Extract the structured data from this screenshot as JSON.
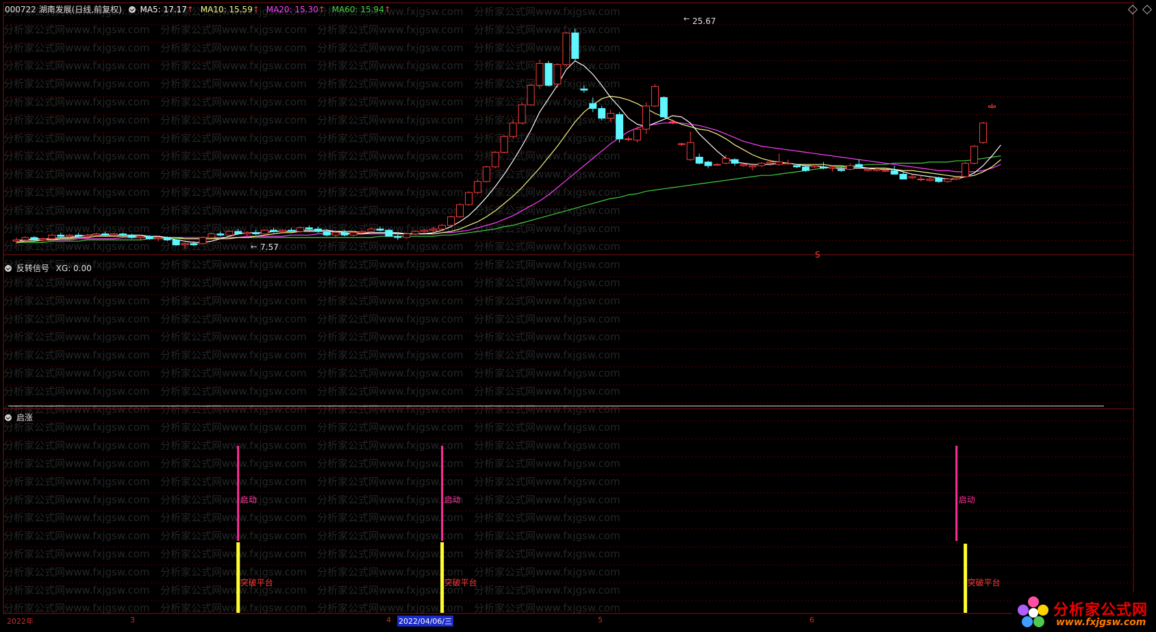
{
  "header": {
    "symbol_title": "000722 湖南发展(日线,前复权)",
    "ma5": "MA5: 17.17",
    "ma10": "MA10: 15.59",
    "ma20": "MA20: 15.30",
    "ma60": "MA60: 15.94",
    "arrow": "↑"
  },
  "colors": {
    "up": "#ff3c3c",
    "down": "#5ff6ff",
    "ma5": "#ffffff",
    "ma10": "#f5f58c",
    "ma20": "#ff40ff",
    "ma60": "#40d040",
    "grid": "#5a0000",
    "signal_start": "#ff2f9a",
    "signal_breakout": "#ffff30"
  },
  "price_pane": {
    "high_label": "25.67",
    "low_label": "7.57",
    "s_marker": "S",
    "price_range": [
      7.2,
      26.6
    ]
  },
  "reversal_pane": {
    "title": "反转信号",
    "value": "XG: 0.00"
  },
  "rise_pane": {
    "title": "启涨",
    "start_label": "启动",
    "breakout_label": "突破平台"
  },
  "date_axis": {
    "labels": [
      "2022年",
      "3",
      "4",
      "2022/04/06/三",
      "5",
      "6"
    ]
  },
  "watermark": {
    "text": "分析家公式网www.fxjgsw.com"
  },
  "logo": {
    "title": "分析家公式网",
    "url": "www.fxjgsw.com"
  },
  "chart_data": {
    "type": "candlestick",
    "ohlc": [
      [
        8.2,
        8.5,
        8.0,
        8.3
      ],
      [
        8.3,
        8.6,
        8.1,
        8.5
      ],
      [
        8.5,
        8.6,
        8.2,
        8.3
      ],
      [
        8.3,
        8.5,
        8.1,
        8.4
      ],
      [
        8.4,
        8.8,
        8.3,
        8.7
      ],
      [
        8.7,
        8.9,
        8.5,
        8.6
      ],
      [
        8.6,
        8.8,
        8.4,
        8.7
      ],
      [
        8.7,
        8.9,
        8.5,
        8.6
      ],
      [
        8.6,
        8.8,
        8.4,
        8.7
      ],
      [
        8.7,
        8.9,
        8.6,
        8.8
      ],
      [
        8.8,
        9.0,
        8.6,
        8.7
      ],
      [
        8.7,
        8.9,
        8.5,
        8.8
      ],
      [
        8.8,
        8.9,
        8.6,
        8.7
      ],
      [
        8.7,
        8.8,
        8.4,
        8.5
      ],
      [
        8.5,
        8.7,
        8.3,
        8.6
      ],
      [
        8.6,
        8.7,
        8.3,
        8.4
      ],
      [
        8.4,
        8.6,
        8.2,
        8.5
      ],
      [
        8.5,
        8.6,
        8.2,
        8.3
      ],
      [
        8.3,
        8.4,
        7.8,
        7.9
      ],
      [
        7.9,
        8.1,
        7.57,
        8.0
      ],
      [
        8.0,
        8.2,
        7.8,
        7.9
      ],
      [
        8.0,
        8.6,
        7.9,
        8.5
      ],
      [
        8.5,
        8.9,
        8.4,
        8.8
      ],
      [
        8.8,
        9.0,
        8.6,
        8.7
      ],
      [
        8.7,
        9.1,
        8.6,
        9.0
      ],
      [
        9.0,
        9.2,
        8.7,
        8.8
      ],
      [
        8.8,
        9.0,
        8.6,
        8.9
      ],
      [
        8.9,
        9.1,
        8.7,
        8.8
      ],
      [
        8.8,
        9.2,
        8.7,
        9.1
      ],
      [
        9.1,
        9.3,
        8.9,
        9.0
      ],
      [
        9.0,
        9.2,
        8.8,
        9.1
      ],
      [
        9.1,
        9.3,
        8.9,
        9.0
      ],
      [
        9.0,
        9.4,
        8.9,
        9.3
      ],
      [
        9.3,
        9.5,
        9.0,
        9.2
      ],
      [
        9.2,
        9.4,
        8.9,
        9.0
      ],
      [
        9.0,
        9.2,
        8.6,
        8.7
      ],
      [
        8.7,
        9.0,
        8.5,
        8.9
      ],
      [
        8.9,
        9.1,
        8.6,
        8.7
      ],
      [
        8.7,
        9.0,
        8.6,
        8.9
      ],
      [
        8.9,
        9.1,
        8.7,
        9.0
      ],
      [
        9.0,
        9.3,
        8.9,
        9.2
      ],
      [
        9.2,
        9.4,
        9.0,
        9.1
      ],
      [
        9.1,
        9.2,
        8.6,
        8.6
      ],
      [
        8.6,
        8.8,
        8.3,
        8.5
      ],
      [
        8.5,
        8.9,
        8.4,
        8.8
      ],
      [
        8.8,
        9.1,
        8.7,
        9.0
      ],
      [
        9.0,
        9.2,
        8.9,
        9.1
      ],
      [
        9.1,
        9.4,
        8.7,
        9.2
      ],
      [
        9.2,
        9.6,
        9.0,
        9.5
      ],
      [
        9.5,
        10.3,
        9.4,
        10.2
      ],
      [
        10.2,
        11.3,
        10.1,
        11.2
      ],
      [
        11.2,
        12.3,
        11.1,
        12.2
      ],
      [
        12.2,
        13.3,
        12.1,
        13.1
      ],
      [
        13.1,
        14.4,
        13.0,
        14.3
      ],
      [
        14.3,
        15.6,
        14.2,
        15.5
      ],
      [
        15.5,
        16.9,
        15.4,
        16.8
      ],
      [
        16.8,
        18.2,
        16.6,
        17.9
      ],
      [
        17.9,
        19.6,
        17.8,
        19.4
      ],
      [
        19.4,
        21.1,
        19.3,
        21.0
      ],
      [
        21.0,
        23.1,
        20.7,
        22.8
      ],
      [
        22.8,
        23.0,
        20.9,
        21.0
      ],
      [
        21.1,
        22.8,
        20.8,
        22.7
      ],
      [
        22.7,
        25.4,
        22.5,
        25.3
      ],
      [
        25.3,
        25.67,
        23.0,
        23.2
      ],
      [
        20.7,
        21.0,
        20.4,
        20.6
      ],
      [
        19.5,
        20.0,
        18.8,
        19.1
      ],
      [
        19.1,
        19.3,
        18.1,
        18.3
      ],
      [
        18.3,
        19.0,
        18.0,
        18.7
      ],
      [
        18.6,
        18.8,
        16.3,
        16.6
      ],
      [
        16.6,
        16.8,
        16.4,
        16.6
      ],
      [
        16.5,
        17.6,
        16.3,
        17.4
      ],
      [
        17.4,
        19.6,
        17.0,
        19.3
      ],
      [
        19.3,
        21.1,
        19.2,
        20.9
      ],
      [
        20.0,
        20.1,
        18.4,
        18.4
      ],
      [
        18.0,
        18.2,
        17.8,
        18.0
      ],
      [
        16.2,
        16.3,
        16.0,
        16.2
      ],
      [
        14.9,
        17.2,
        14.8,
        16.3
      ],
      [
        15.1,
        15.4,
        14.5,
        14.6
      ],
      [
        14.7,
        14.8,
        14.2,
        14.4
      ],
      [
        14.5,
        14.6,
        14.4,
        14.5
      ],
      [
        14.6,
        15.3,
        14.5,
        15.0
      ],
      [
        14.9,
        15.0,
        14.4,
        14.6
      ],
      [
        14.4,
        14.6,
        14.3,
        14.5
      ],
      [
        14.3,
        14.6,
        14.0,
        14.4
      ],
      [
        14.4,
        14.7,
        14.3,
        14.6
      ],
      [
        14.6,
        14.9,
        14.4,
        14.7
      ],
      [
        14.5,
        15.4,
        14.4,
        14.7
      ],
      [
        14.6,
        14.9,
        14.5,
        14.6
      ],
      [
        14.4,
        14.5,
        14.2,
        14.3
      ],
      [
        14.3,
        14.4,
        13.9,
        14.0
      ],
      [
        14.3,
        14.5,
        14.2,
        14.4
      ],
      [
        14.3,
        14.7,
        14.1,
        14.2
      ],
      [
        14.2,
        14.4,
        13.9,
        14.3
      ],
      [
        14.1,
        14.3,
        13.9,
        14.0
      ],
      [
        14.1,
        14.6,
        14.0,
        14.4
      ],
      [
        14.5,
        14.9,
        14.3,
        14.3
      ],
      [
        14.0,
        14.3,
        13.9,
        14.1
      ],
      [
        14.0,
        14.3,
        13.9,
        14.1
      ],
      [
        14.0,
        14.2,
        13.9,
        14.0
      ],
      [
        14.0,
        14.4,
        13.7,
        13.7
      ],
      [
        13.7,
        14.0,
        13.3,
        13.3
      ],
      [
        13.4,
        13.7,
        13.3,
        13.5
      ],
      [
        13.3,
        13.6,
        13.1,
        13.3
      ],
      [
        13.2,
        13.5,
        13.1,
        13.3
      ],
      [
        13.4,
        13.5,
        13.0,
        13.1
      ],
      [
        13.1,
        13.4,
        13.0,
        13.3
      ],
      [
        13.3,
        13.5,
        13.2,
        13.4
      ],
      [
        13.5,
        14.7,
        13.4,
        14.6
      ],
      [
        14.6,
        16.1,
        14.5,
        16.0
      ],
      [
        16.3,
        18.0,
        16.2,
        17.9
      ],
      [
        19.2,
        19.5,
        19.1,
        19.3
      ]
    ],
    "ma5": [
      8.2,
      8.3,
      8.4,
      8.4,
      8.4,
      8.5,
      8.5,
      8.6,
      8.7,
      8.7,
      8.7,
      8.7,
      8.7,
      8.7,
      8.7,
      8.6,
      8.6,
      8.5,
      8.3,
      8.2,
      8.1,
      8.1,
      8.2,
      8.4,
      8.6,
      8.8,
      8.9,
      8.9,
      8.9,
      9.0,
      9.0,
      9.0,
      9.1,
      9.1,
      9.1,
      9.1,
      9.0,
      8.9,
      8.8,
      8.8,
      8.9,
      8.9,
      8.9,
      8.9,
      8.8,
      8.8,
      8.8,
      8.9,
      9.1,
      9.4,
      9.8,
      10.3,
      11.0,
      11.8,
      12.7,
      13.7,
      14.8,
      16.0,
      17.3,
      18.8,
      19.9,
      21.0,
      22.3,
      23.0,
      22.6,
      21.9,
      21.0,
      20.0,
      19.2,
      18.3,
      17.8,
      17.6,
      17.9,
      18.2,
      18.5,
      18.4,
      17.9,
      17.0,
      16.3,
      15.6,
      15.0,
      14.7,
      14.6,
      14.5,
      14.5,
      14.5,
      14.6,
      14.6,
      14.5,
      14.4,
      14.4,
      14.3,
      14.2,
      14.2,
      14.2,
      14.2,
      14.2,
      14.1,
      14.1,
      14.1,
      13.9,
      13.7,
      13.6,
      13.5,
      13.4,
      13.3,
      13.3,
      13.5,
      13.8,
      14.4,
      15.2,
      16.1
    ],
    "ma10": [
      8.1,
      8.2,
      8.2,
      8.3,
      8.3,
      8.4,
      8.4,
      8.5,
      8.5,
      8.6,
      8.6,
      8.6,
      8.6,
      8.6,
      8.6,
      8.6,
      8.6,
      8.5,
      8.5,
      8.4,
      8.4,
      8.4,
      8.4,
      8.4,
      8.4,
      8.5,
      8.5,
      8.6,
      8.7,
      8.8,
      8.9,
      8.9,
      9.0,
      9.0,
      9.0,
      9.0,
      9.0,
      9.0,
      9.0,
      8.9,
      8.9,
      8.9,
      8.9,
      8.8,
      8.8,
      8.8,
      8.8,
      8.8,
      8.9,
      9.0,
      9.2,
      9.5,
      9.8,
      10.2,
      10.7,
      11.3,
      11.9,
      12.6,
      13.4,
      14.2,
      15.1,
      16.0,
      17.0,
      18.0,
      18.8,
      19.4,
      19.9,
      20.1,
      20.0,
      19.8,
      19.5,
      19.1,
      18.7,
      18.4,
      18.1,
      17.8,
      17.6,
      17.4,
      17.3,
      17.0,
      16.6,
      16.1,
      15.7,
      15.3,
      15.0,
      14.8,
      14.7,
      14.6,
      14.5,
      14.5,
      14.5,
      14.5,
      14.4,
      14.4,
      14.3,
      14.3,
      14.2,
      14.2,
      14.2,
      14.1,
      14.0,
      14.0,
      13.9,
      13.8,
      13.7,
      13.6,
      13.5,
      13.5,
      13.6,
      13.9,
      14.3,
      14.9
    ],
    "ma20": [
      8.3,
      8.3,
      8.3,
      8.3,
      8.3,
      8.3,
      8.3,
      8.4,
      8.4,
      8.4,
      8.4,
      8.4,
      8.5,
      8.5,
      8.5,
      8.5,
      8.5,
      8.5,
      8.5,
      8.5,
      8.5,
      8.5,
      8.5,
      8.5,
      8.5,
      8.5,
      8.6,
      8.6,
      8.6,
      8.6,
      8.6,
      8.7,
      8.7,
      8.7,
      8.8,
      8.8,
      8.8,
      8.8,
      8.8,
      8.8,
      8.8,
      8.8,
      8.8,
      8.8,
      8.8,
      8.8,
      8.8,
      8.8,
      8.9,
      8.9,
      9.0,
      9.1,
      9.3,
      9.5,
      9.7,
      10.0,
      10.3,
      10.7,
      11.1,
      11.5,
      12.0,
      12.6,
      13.2,
      13.8,
      14.4,
      15.0,
      15.6,
      16.2,
      16.7,
      17.2,
      17.5,
      17.7,
      17.8,
      17.9,
      17.9,
      17.9,
      17.8,
      17.7,
      17.5,
      17.3,
      17.0,
      16.7,
      16.4,
      16.2,
      16.0,
      15.9,
      15.8,
      15.7,
      15.6,
      15.5,
      15.4,
      15.3,
      15.2,
      15.1,
      15.0,
      14.9,
      14.8,
      14.7,
      14.6,
      14.5,
      14.4,
      14.3,
      14.2,
      14.1,
      14.0,
      14.0,
      13.9,
      13.9,
      13.9,
      14.0,
      14.2,
      14.5
    ],
    "ma60": [
      8.1,
      8.1,
      8.1,
      8.1,
      8.2,
      8.2,
      8.2,
      8.2,
      8.3,
      8.3,
      8.3,
      8.3,
      8.3,
      8.3,
      8.3,
      8.4,
      8.4,
      8.4,
      8.4,
      8.4,
      8.4,
      8.4,
      8.4,
      8.5,
      8.5,
      8.5,
      8.5,
      8.5,
      8.5,
      8.5,
      8.5,
      8.5,
      8.5,
      8.5,
      8.5,
      8.5,
      8.5,
      8.5,
      8.5,
      8.5,
      8.5,
      8.6,
      8.6,
      8.6,
      8.6,
      8.6,
      8.6,
      8.6,
      8.7,
      8.7,
      8.8,
      8.9,
      9.0,
      9.1,
      9.2,
      9.4,
      9.5,
      9.7,
      9.9,
      10.1,
      10.3,
      10.5,
      10.7,
      10.9,
      11.1,
      11.3,
      11.5,
      11.7,
      11.8,
      12.0,
      12.1,
      12.3,
      12.4,
      12.5,
      12.6,
      12.7,
      12.8,
      12.9,
      13.0,
      13.1,
      13.2,
      13.3,
      13.4,
      13.5,
      13.6,
      13.6,
      13.7,
      13.8,
      13.9,
      14.0,
      14.1,
      14.2,
      14.3,
      14.3,
      14.4,
      14.4,
      14.5,
      14.5,
      14.5,
      14.6,
      14.6,
      14.6,
      14.6,
      14.7,
      14.7,
      14.7,
      14.8,
      14.8,
      14.9,
      15.0,
      15.1,
      15.2
    ],
    "rise_signals": [
      {
        "index": 25,
        "start": true,
        "breakout": true
      },
      {
        "index": 48,
        "start": true,
        "breakout": true
      },
      {
        "index": 106,
        "start": true,
        "breakout": false
      },
      {
        "index": 107,
        "start": false,
        "breakout": true
      }
    ]
  }
}
